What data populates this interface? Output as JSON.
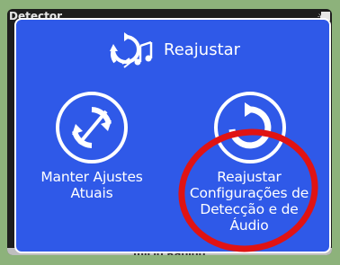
{
  "app": {
    "title": "Detector",
    "bottom_label": "Início Rápido"
  },
  "dialog": {
    "title": "Reajustar",
    "title_icon": "reset-audio-icon",
    "options": [
      {
        "label": "Manter Ajustes\nAtuais",
        "icon": "keep-settings-icon"
      },
      {
        "label": "Reajustar\nConfigurações de\nDetecção e de\nÁudio",
        "icon": "reset-settings-icon"
      }
    ]
  },
  "colors": {
    "dialog_bg": "#2f59e8",
    "border": "#ffffff",
    "highlight_ring": "#e01313",
    "page_bg": "#8db27b"
  }
}
